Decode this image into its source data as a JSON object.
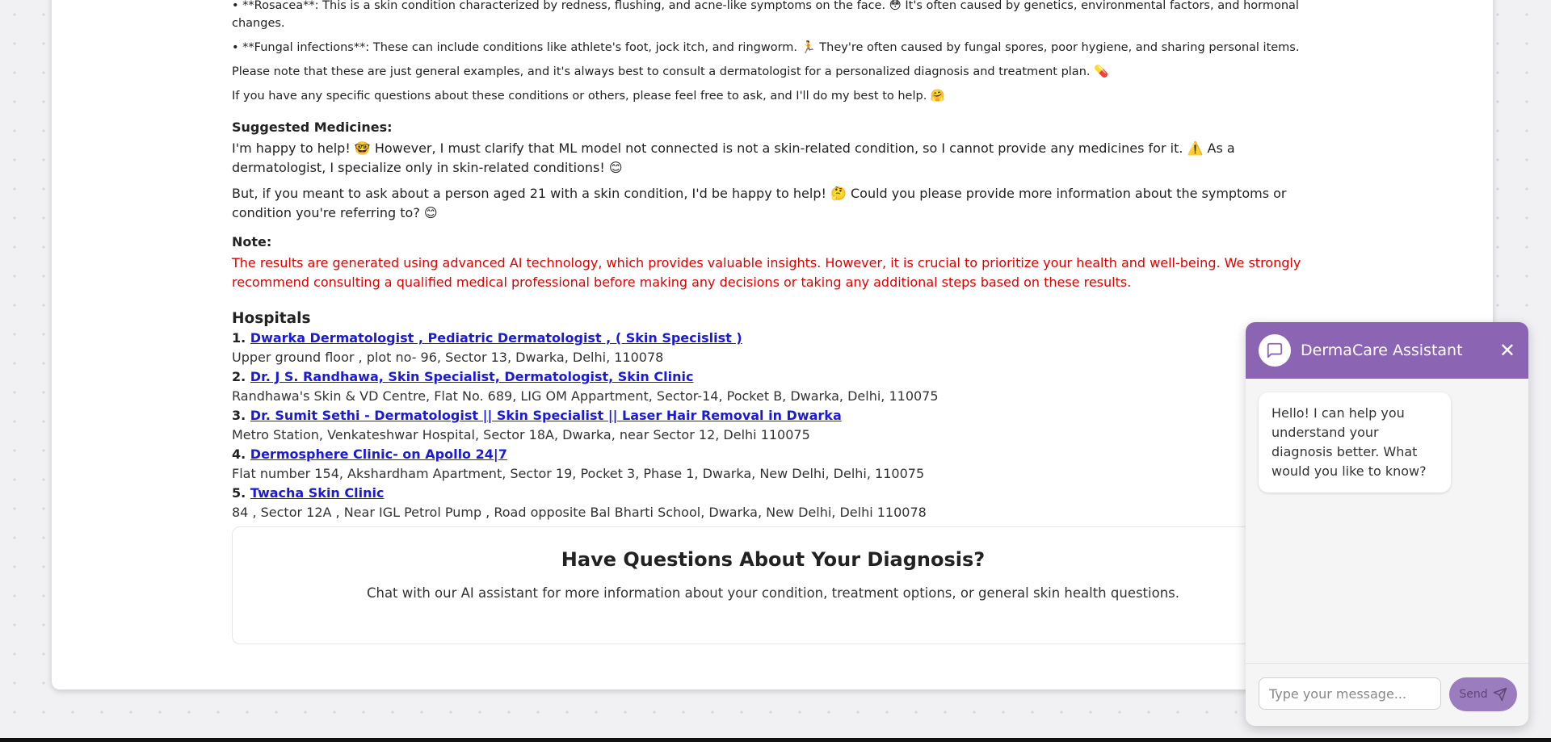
{
  "diagnosis_details": {
    "bullets": [
      "• **Rosacea**: This is a skin condition characterized by redness, flushing, and acne-like symptoms on the face. 😳 It's often caused by genetics, environmental factors, and hormonal changes.",
      "• **Fungal infections**: These can include conditions like athlete's foot, jock itch, and ringworm. 🏃 They're often caused by fungal spores, poor hygiene, and sharing personal items."
    ],
    "closing": [
      "Please note that these are just general examples, and it's always best to consult a dermatologist for a personalized diagnosis and treatment plan. 💊",
      "If you have any specific questions about these conditions or others, please feel free to ask, and I'll do my best to help. 🤗"
    ]
  },
  "medicines": {
    "heading": "Suggested Medicines:",
    "paragraphs": [
      "I'm happy to help! 🤓 However, I must clarify that ML model not connected is not a skin-related condition, so I cannot provide any medicines for it. ⚠️ As a dermatologist, I specialize only in skin-related conditions! 😊",
      "But, if you meant to ask about a person aged 21 with a skin condition, I'd be happy to help! 🤔 Could you please provide more information about the symptoms or condition you're referring to? 😊"
    ]
  },
  "note": {
    "heading": "Note:",
    "text": "The results are generated using advanced AI technology, which provides valuable insights. However, it is crucial to prioritize your health and well-being. We strongly recommend consulting a qualified medical professional before making any decisions or taking any additional steps based on these results."
  },
  "hospitals": {
    "heading": "Hospitals",
    "items": [
      {
        "num": "1.",
        "name": "Dwarka Dermatologist , Pediatric Dermatologist , ( Skin Specislist )",
        "address": "Upper ground floor , plot no- 96, Sector 13, Dwarka, Delhi, 110078"
      },
      {
        "num": "2.",
        "name": "Dr. J S. Randhawa, Skin Specialist, Dermatologist, Skin Clinic",
        "address": "Randhawa's Skin & VD Centre, Flat No. 689, LIG OM Appartment, Sector-14, Pocket B, Dwarka, Delhi, 110075"
      },
      {
        "num": "3.",
        "name": "Dr. Sumit Sethi - Dermatologist || Skin Specialist || Laser Hair Removal in Dwarka",
        "address": "Metro Station, Venkateshwar Hospital, Sector 18A, Dwarka, near Sector 12, Delhi 110075"
      },
      {
        "num": "4.",
        "name": "Dermosphere Clinic- on Apollo 24|7",
        "address": "Flat number 154, Akshardham Apartment, Sector 19, Pocket 3, Phase 1, Dwarka, New Delhi, Delhi, 110075"
      },
      {
        "num": "5.",
        "name": "Twacha Skin Clinic",
        "address": "84 , Sector 12A , Near IGL Petrol Pump , Road opposite Bal Bharti School, Dwarka, New Delhi, Delhi 110078"
      }
    ]
  },
  "questions_box": {
    "title": "Have Questions About Your Diagnosis?",
    "subtitle": "Chat with our AI assistant for more information about your condition, treatment options, or general skin health questions."
  },
  "chat_panel": {
    "title": "DermaCare Assistant",
    "close_label": "✕",
    "assistant_message": "Hello! I can help you understand your diagnosis better. What would you like to know?",
    "input_placeholder": "Type your message...",
    "send_label": "Send",
    "header_color": "#8b64b4"
  }
}
